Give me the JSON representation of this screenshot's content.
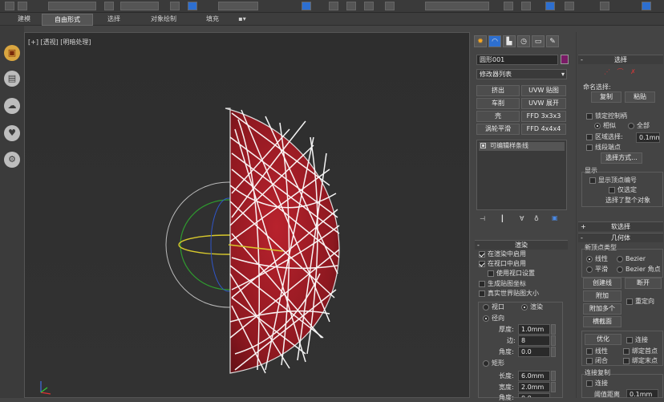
{
  "ribbon": {
    "tabs": [
      "建模",
      "自由形式",
      "选择",
      "对象绘制",
      "填充"
    ],
    "active_tab": "自由形式"
  },
  "viewport": {
    "label": "[+] [透视] [明暗处理]"
  },
  "command_panel": {
    "object_name": "圆形001",
    "modifier_list": "修改器列表",
    "modifier_buttons": [
      "挤出",
      "UVW 贴图",
      "车削",
      "UVW 展开",
      "壳",
      "FFD 3x3x3",
      "涡轮平滑",
      "FFD 4x4x4"
    ],
    "stack_item": "可编辑样条线",
    "render": {
      "header": "渲染",
      "enable_in_render": "在渲染中启用",
      "enable_in_viewport": "在视口中启用",
      "use_viewport_settings": "使用视口设置",
      "gen_mapping": "生成贴图坐标",
      "real_world": "真实世界贴图大小",
      "viewport": "视口",
      "renderer": "渲染",
      "radial": "径向",
      "thickness_label": "厚度:",
      "thickness": "1.0mm",
      "sides_label": "边:",
      "sides": "8",
      "angle_label": "角度:",
      "angle": "0.0",
      "rect": "矩形",
      "length_label": "长度:",
      "length": "6.0mm",
      "width_label": "宽度:",
      "width": "2.0mm",
      "angle2_label": "角度:",
      "angle2": "0.0"
    }
  },
  "right_panel": {
    "selection_header": "选择",
    "named_selection": "命名选择:",
    "copy": "复制",
    "paste": "粘贴",
    "lock_handles": "锁定控制柄",
    "similar": "相似",
    "all": "全部",
    "area_select": "区域选择:",
    "area_value": "0.1mm",
    "segment_end": "线段端点",
    "select_by": "选择方式...",
    "display": "显示",
    "show_vertex_numbers": "显示顶点编号",
    "selected_only": "仅选定",
    "selected_status": "选择了整个对象",
    "soft_selection": "软选择",
    "geometry": "几何体",
    "new_vertex_type": "新顶点类型",
    "linear": "线性",
    "bezier": "Bezier",
    "smooth": "平滑",
    "bezier_corner": "Bezier 角点",
    "create_line": "创建线",
    "break": "断开",
    "attach": "附加",
    "reorient": "重定向",
    "attach_mult": "附加多个",
    "cross_section": "横截面",
    "refine": "优化",
    "connect": "连接",
    "linear2": "线性",
    "bind_first": "绑定首点",
    "closed": "闭合",
    "bind_last": "绑定末点",
    "connect_copy": "连接复制",
    "connect2": "连接",
    "threshold": "阈值距离",
    "threshold_value": "0.1mm"
  }
}
